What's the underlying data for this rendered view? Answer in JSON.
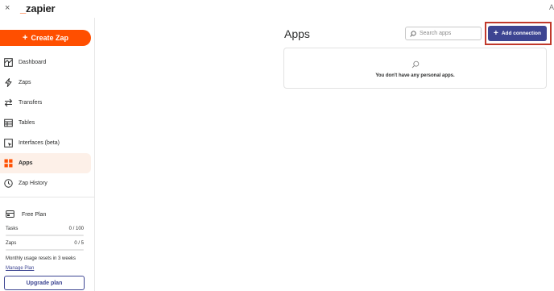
{
  "topbar": {
    "close_glyph": "×",
    "logo_text": "zapier",
    "logo_underscore": "_",
    "edge_glyph": "A"
  },
  "sidebar": {
    "create_label": "Create Zap",
    "items": [
      {
        "label": "Dashboard",
        "icon": "dashboard-icon",
        "active": false
      },
      {
        "label": "Zaps",
        "icon": "zap-icon",
        "active": false
      },
      {
        "label": "Transfers",
        "icon": "transfers-icon",
        "active": false
      },
      {
        "label": "Tables",
        "icon": "tables-icon",
        "active": false
      },
      {
        "label": "Interfaces (beta)",
        "icon": "interfaces-icon",
        "active": false
      },
      {
        "label": "Apps",
        "icon": "apps-icon",
        "active": true
      },
      {
        "label": "Zap History",
        "icon": "history-icon",
        "active": false
      }
    ],
    "plan": {
      "name": "Free Plan",
      "tasks_label": "Tasks",
      "tasks_value": "0 / 100",
      "zaps_label": "Zaps",
      "zaps_value": "0 / 5",
      "reset_text": "Monthly usage resets in 3 weeks",
      "manage_label": "Manage Plan",
      "upgrade_label": "Upgrade plan"
    }
  },
  "main": {
    "title": "Apps",
    "search_placeholder": "Search apps",
    "add_label": "Add connection",
    "empty_text": "You don't have any personal apps."
  },
  "colors": {
    "brand": "#ff4f00",
    "primary": "#3d4592",
    "highlight": "#c0392b",
    "active_bg": "#fdf0e8"
  }
}
